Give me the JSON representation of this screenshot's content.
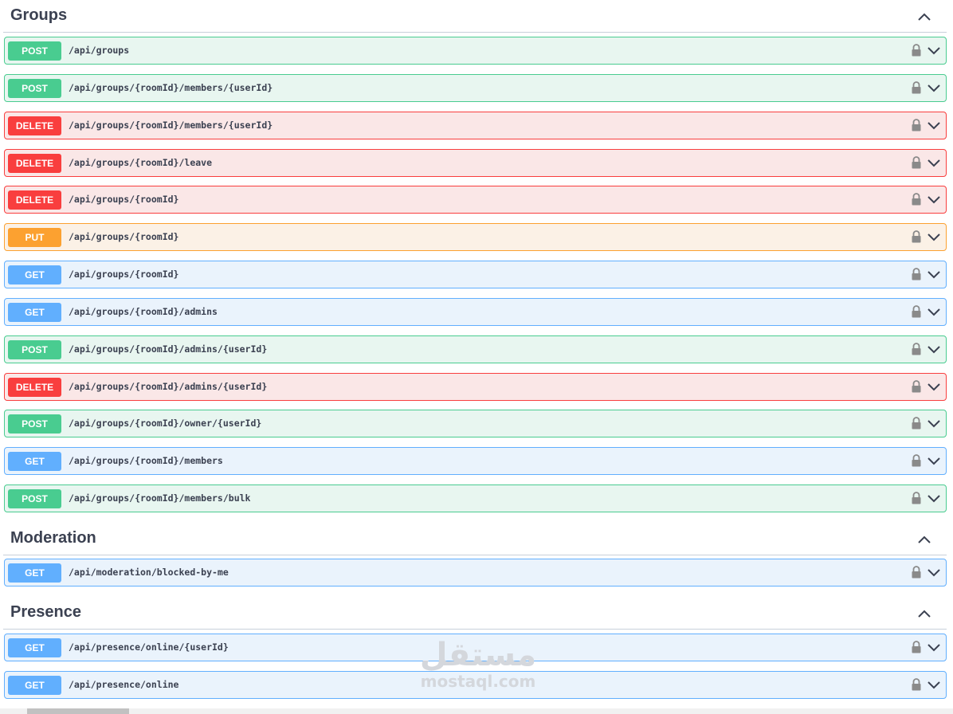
{
  "sections": [
    {
      "title": "Groups"
    },
    {
      "title": "Moderation"
    },
    {
      "title": "Presence"
    }
  ],
  "operations": [
    {
      "method": "POST",
      "path": "/api/groups"
    },
    {
      "method": "POST",
      "path": "/api/groups/{roomId}/members/{userId}"
    },
    {
      "method": "DELETE",
      "path": "/api/groups/{roomId}/members/{userId}"
    },
    {
      "method": "DELETE",
      "path": "/api/groups/{roomId}/leave"
    },
    {
      "method": "DELETE",
      "path": "/api/groups/{roomId}"
    },
    {
      "method": "PUT",
      "path": "/api/groups/{roomId}"
    },
    {
      "method": "GET",
      "path": "/api/groups/{roomId}"
    },
    {
      "method": "GET",
      "path": "/api/groups/{roomId}/admins"
    },
    {
      "method": "POST",
      "path": "/api/groups/{roomId}/admins/{userId}"
    },
    {
      "method": "DELETE",
      "path": "/api/groups/{roomId}/admins/{userId}"
    },
    {
      "method": "POST",
      "path": "/api/groups/{roomId}/owner/{userId}"
    },
    {
      "method": "GET",
      "path": "/api/groups/{roomId}/members"
    },
    {
      "method": "POST",
      "path": "/api/groups/{roomId}/members/bulk"
    },
    {
      "method": "GET",
      "path": "/api/moderation/blocked-by-me"
    },
    {
      "method": "GET",
      "path": "/api/presence/online/{userId}"
    },
    {
      "method": "GET",
      "path": "/api/presence/online"
    }
  ],
  "icons": {
    "section_toggle": "chevron-up-icon",
    "lock": "lock-icon",
    "expand": "chevron-down-icon"
  },
  "colors": {
    "post": "#49cc90",
    "delete": "#f93e3e",
    "put": "#fca130",
    "get": "#61afe"
  },
  "watermark": {
    "arabic": "مستقل",
    "latin": "mostaql.com"
  }
}
